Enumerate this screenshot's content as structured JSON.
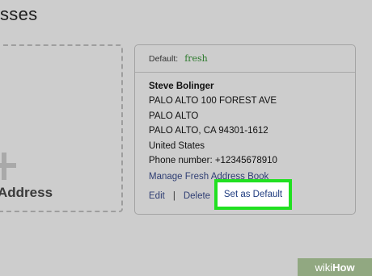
{
  "page": {
    "title": "sses"
  },
  "add_address": {
    "label": "Address"
  },
  "address_card": {
    "default_label": "Default:",
    "badge": "fresh",
    "name": "Steve Bolinger",
    "lines": [
      "PALO ALTO 100 FOREST AVE",
      "PALO ALTO",
      "PALO ALTO, CA 94301-1612",
      "United States",
      "Phone number: +12345678910"
    ],
    "manage_link": "Manage Fresh Address Book",
    "edit": "Edit",
    "separator": "|",
    "delete": "Delete",
    "set_default": "Set as Default"
  },
  "watermark": {
    "part1": "wiki",
    "part2": "How"
  },
  "colors": {
    "highlight": "#21e021",
    "link": "#2f3e73",
    "fresh": "#2c7a2c"
  }
}
